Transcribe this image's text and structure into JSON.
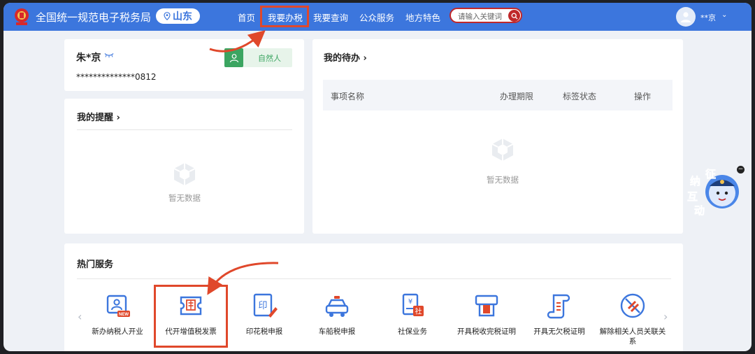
{
  "header": {
    "site_title": "全国统一规范电子税务局",
    "region": "山东",
    "nav": [
      "首页",
      "我要办税",
      "我要查询",
      "公众服务",
      "地方特色"
    ],
    "search_placeholder": "请输入关键词",
    "user_name": "**京"
  },
  "profile": {
    "name": "朱*京",
    "id_masked": "**************0812",
    "type_tag": "自然人"
  },
  "reminders": {
    "title": "我的提醒 ›",
    "empty": "暂无数据"
  },
  "todo": {
    "title": "我的待办 ›",
    "columns": [
      "事项名称",
      "办理期限",
      "标签状态",
      "操作"
    ],
    "empty": "暂无数据"
  },
  "hot_services": {
    "title": "热门服务",
    "items": [
      {
        "label": "新办纳税人开业",
        "icon": "new-taxpayer-icon"
      },
      {
        "label": "代开增值税发票",
        "icon": "vat-invoice-icon"
      },
      {
        "label": "印花税申报",
        "icon": "stamp-tax-icon"
      },
      {
        "label": "车船税申报",
        "icon": "vehicle-tax-icon"
      },
      {
        "label": "社保业务",
        "icon": "social-security-icon"
      },
      {
        "label": "开具税收完税证明",
        "icon": "tax-payment-certificate-icon"
      },
      {
        "label": "开具无欠税证明",
        "icon": "no-arrears-certificate-icon"
      },
      {
        "label": "解除相关人员关联关系",
        "icon": "unlink-relationship-icon"
      }
    ]
  },
  "mascot": {
    "text": [
      "征",
      "纳",
      "互",
      "动"
    ]
  },
  "colors": {
    "primary": "#3c76dd",
    "accent_red": "#c0282a",
    "annotation": "#e0482b",
    "green": "#3ba561"
  }
}
